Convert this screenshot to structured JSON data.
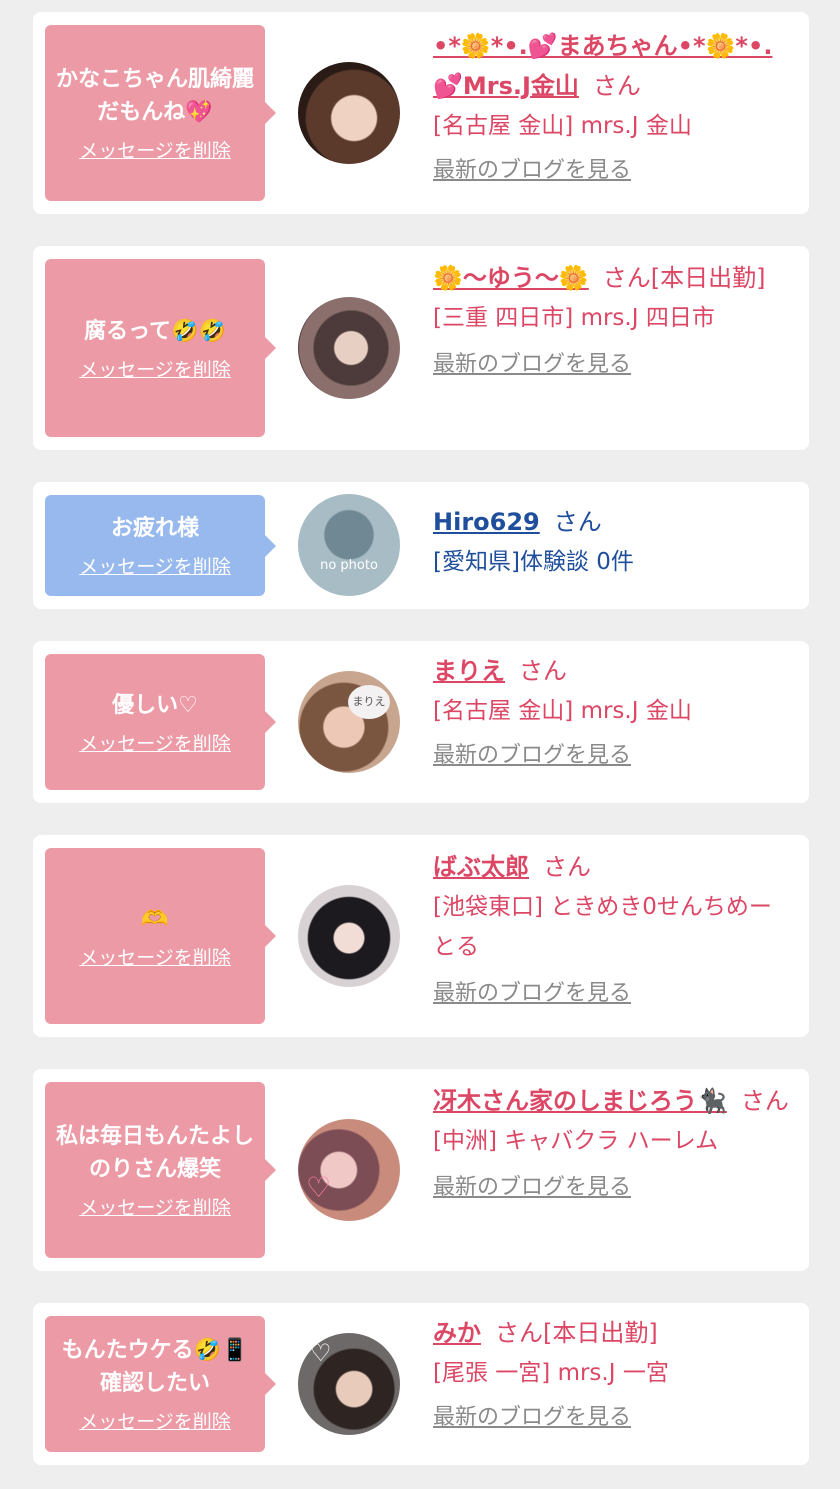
{
  "delete_label": "メッセージを削除",
  "blog_label": "最新のブログを見る",
  "colors": {
    "bubble_pink": "#ec9aa5",
    "bubble_blue": "#98b9ee",
    "name_pink": "#dc4765",
    "name_blue": "#1f4f9c",
    "link_gray": "#8a8a8a"
  },
  "items": [
    {
      "message": "かなこちゃん肌綺麗だもんね💖",
      "name": "•*🌼*•.💕まあちゃん•*🌼*•.💕Mrs.J金山",
      "suffix": "さん",
      "shop": "[名古屋 金山] mrs.J 金山"
    },
    {
      "message": "腐るって🤣🤣",
      "name": "🌼〜ゆう〜🌼",
      "suffix": "さん[本日出勤]",
      "shop": "[三重 四日市] mrs.J 四日市"
    },
    {
      "message": "お疲れ様",
      "name": "Hiro629",
      "suffix": "さん",
      "shop": "[愛知県]体験談 0件",
      "avatar_text": "no photo"
    },
    {
      "message": "優しい♡",
      "name": "まりえ",
      "suffix": "さん",
      "shop": "[名古屋 金山] mrs.J 金山",
      "avatar_text": "まりえ"
    },
    {
      "message": "🫶",
      "name": "ばぶ太郎",
      "suffix": "さん",
      "shop": "[池袋東口] ときめき0せんちめーとる"
    },
    {
      "message": "私は毎日もんたよしのりさん爆笑",
      "name": "冴木さん家のしまじろう🐈‍⬛",
      "suffix": "さん",
      "shop": "[中洲] キャバクラ ハーレム"
    },
    {
      "message": "もんたウケる🤣📱確認したい",
      "name": "みか",
      "suffix": "さん[本日出勤]",
      "shop": "[尾張 一宮] mrs.J 一宮"
    }
  ]
}
